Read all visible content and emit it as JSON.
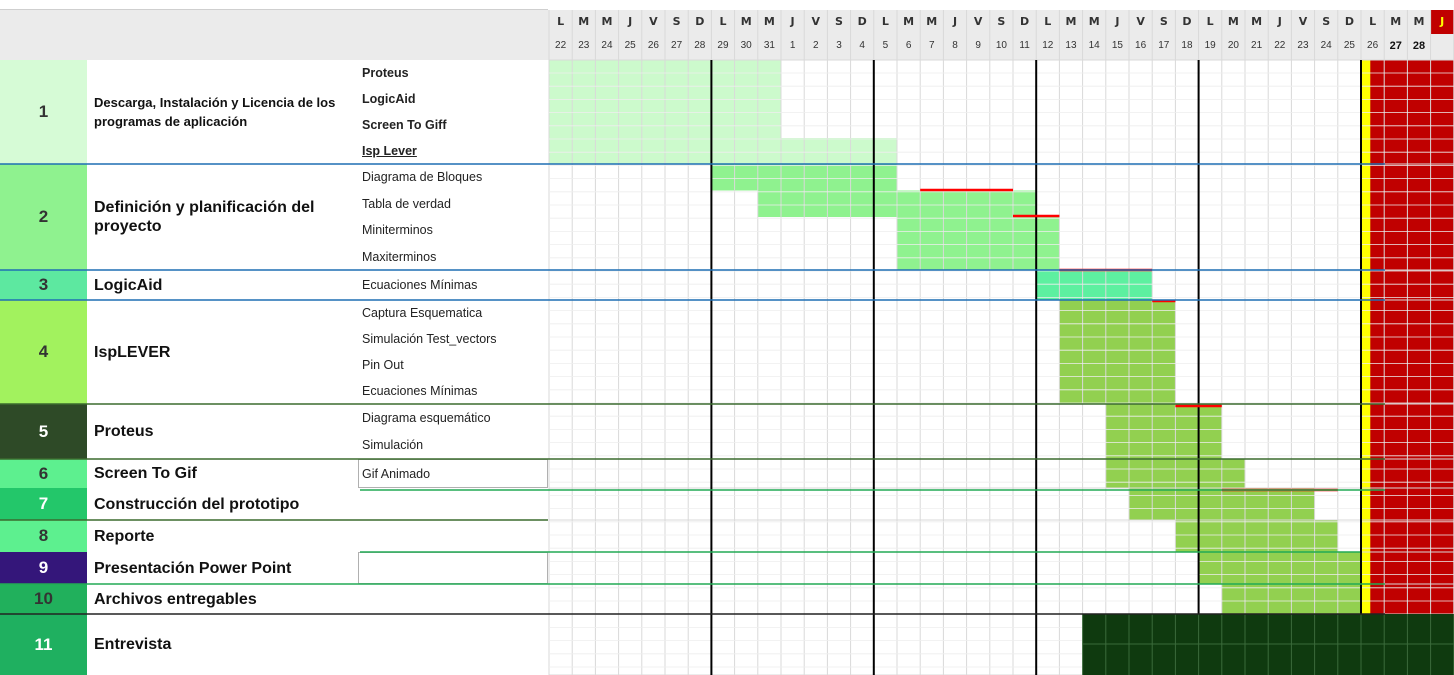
{
  "header": {
    "weekday_letters": [
      "L",
      "M",
      "M",
      "J",
      "V",
      "S",
      "D",
      "L",
      "M",
      "M",
      "J",
      "V",
      "S",
      "D",
      "L",
      "M",
      "M",
      "J",
      "V",
      "S",
      "D",
      "L",
      "M",
      "M",
      "J",
      "V",
      "S",
      "D",
      "L",
      "M",
      "M",
      "J",
      "V",
      "S",
      "D",
      "L",
      "M",
      "M",
      "J"
    ],
    "dates": [
      "22",
      "23",
      "24",
      "25",
      "26",
      "27",
      "28",
      "29",
      "30",
      "31",
      "1",
      "2",
      "3",
      "4",
      "5",
      "6",
      "7",
      "8",
      "9",
      "10",
      "11",
      "12",
      "13",
      "14",
      "15",
      "16",
      "17",
      "18",
      "19",
      "20",
      "21",
      "22",
      "23",
      "24",
      "25",
      "26",
      "27",
      "28",
      ""
    ]
  },
  "rows": [
    {
      "num": "1",
      "num_color": "#d6fbd6",
      "num_dark": true,
      "task": "Descarga, Instalación y Licencia de los programas de aplicación",
      "task_size": 13,
      "subs": [
        "Proteus",
        "LogicAid",
        "Screen To Giff",
        "Isp Lever"
      ],
      "subs_bold": true
    },
    {
      "num": "2",
      "num_color": "#8ff28f",
      "num_dark": true,
      "task": "Definición y planificación del proyecto",
      "task_size": 16,
      "subs": [
        "Diagrama de Bloques",
        "Tabla de verdad",
        "Miniterminos",
        "Maxiterminos"
      ]
    },
    {
      "num": "3",
      "num_color": "#5de8a0",
      "num_dark": true,
      "task": "LogicAid",
      "task_size": 16,
      "subs": [
        "Ecuaciones Mínimas"
      ]
    },
    {
      "num": "4",
      "num_color": "#a2f25e",
      "num_dark": true,
      "task": "IspLEVER",
      "task_size": 16,
      "subs": [
        "Captura Esquematica",
        "Simulación Test_vectors",
        "Pin Out",
        "Ecuaciones Mínimas"
      ]
    },
    {
      "num": "5",
      "num_color": "#2e4a27",
      "num_dark": false,
      "task": "Proteus",
      "task_size": 16,
      "subs": [
        "Diagrama esquemático",
        "Simulación"
      ]
    },
    {
      "num": "6",
      "num_color": "#5df08f",
      "num_dark": true,
      "task": "Screen To Gif",
      "task_size": 16,
      "subs": [
        "Gif Animado"
      ]
    },
    {
      "num": "7",
      "num_color": "#23c76a",
      "num_dark": false,
      "task": "Construcción del prototipo",
      "task_size": 16,
      "subs": []
    },
    {
      "num": "8",
      "num_color": "#5df08f",
      "num_dark": true,
      "task": "Reporte",
      "task_size": 16,
      "subs": []
    },
    {
      "num": "9",
      "num_color": "#34167a",
      "num_dark": false,
      "task": "Presentación Power Point",
      "task_size": 16,
      "subs": []
    },
    {
      "num": "10",
      "num_color": "#21b05c",
      "num_dark": true,
      "task": "Archivos entregables",
      "task_size": 16,
      "subs": []
    },
    {
      "num": "11",
      "num_color": "#1fb060",
      "num_dark": false,
      "task": "Entrevista",
      "task_size": 16,
      "subs": []
    }
  ],
  "colors": {
    "header_bg": "#ebebeb",
    "grid": "#d9d9d9",
    "week_sep": "#000000",
    "today_col": "#ffff00",
    "deadline_col": "#c00000",
    "progress_line": "#ff0000",
    "row_line_blue": "#1f6fb4",
    "row_line_green": "#22aa55",
    "row_line_olive": "#3b6b2f"
  },
  "chart_data": {
    "type": "gantt",
    "columns": "days (L M M J V S D)",
    "today_column_date": "26",
    "deadline_column_weekday": "J",
    "bars": [
      {
        "task": "1",
        "start_date": "22",
        "end_date": "31",
        "subrows": [
          1,
          2,
          3,
          4
        ],
        "color": "#ccfacc"
      },
      {
        "task": "1",
        "start_date": "1",
        "end_date": "5",
        "subrows": [
          4
        ],
        "color": "#ccfacc"
      },
      {
        "task": "2",
        "start_date": "29",
        "end_date": "31",
        "subrows": [
          1
        ],
        "color": "#8ff28f"
      },
      {
        "task": "2",
        "start_date": "31",
        "end_date": "5",
        "subrows": [
          1,
          2
        ],
        "color": "#8ff28f"
      },
      {
        "task": "2",
        "start_date": "6",
        "end_date": "11",
        "subrows": [
          2,
          3,
          4
        ],
        "color": "#8ff28f"
      },
      {
        "task": "2",
        "start_date": "12",
        "end_date": "12",
        "subrows": [
          3,
          4
        ],
        "color": "#8ff28f"
      },
      {
        "task": "3",
        "start_date": "12",
        "end_date": "16",
        "subrows": [
          1
        ],
        "color": "#5df0a0"
      },
      {
        "task": "4",
        "start_date": "13",
        "end_date": "17",
        "subrows": [
          1,
          2,
          3,
          4
        ],
        "color": "#92d050"
      },
      {
        "task": "5",
        "start_date": "15",
        "end_date": "19",
        "subrows": [
          1,
          2
        ],
        "color": "#92d050"
      },
      {
        "task": "6",
        "start_date": "15",
        "end_date": "20",
        "subrows": [
          1
        ],
        "color": "#92d050"
      },
      {
        "task": "7",
        "start_date": "16",
        "end_date": "23",
        "subrows": [
          1
        ],
        "color": "#92d050"
      },
      {
        "task": "8",
        "start_date": "18",
        "end_date": "24",
        "subrows": [
          1
        ],
        "color": "#92d050"
      },
      {
        "task": "9",
        "start_date": "19",
        "end_date": "25",
        "subrows": [
          1
        ],
        "color": "#92d050"
      },
      {
        "task": "10",
        "start_date": "20",
        "end_date": "25",
        "subrows": [
          1
        ],
        "color": "#92d050"
      },
      {
        "task": "11",
        "start_date": "14",
        "end_date": "28",
        "subrows": [
          1
        ],
        "color": "#0f3a0f"
      }
    ]
  }
}
